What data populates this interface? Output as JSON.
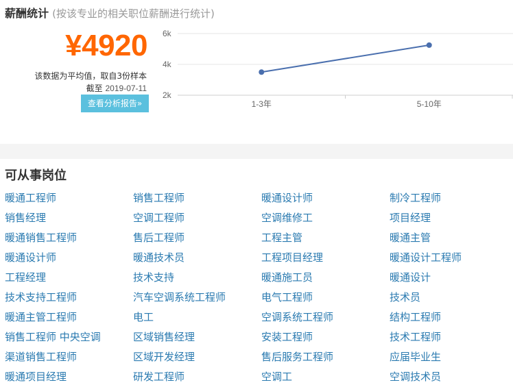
{
  "salary": {
    "title": "薪酬统计",
    "subtitle": "(按该专业的相关职位薪酬进行统计)",
    "value": "¥4920",
    "note": "该数据为平均值，取自3份样本",
    "date_prefix": "截至",
    "date": "2019-07-11",
    "report_button": "查看分析报告»"
  },
  "chart_data": {
    "type": "line",
    "categories": [
      "1-3年",
      "5-10年"
    ],
    "series": [
      {
        "values": [
          3500,
          5250
        ]
      }
    ],
    "y_ticks": [
      "6k",
      "4k",
      "2k"
    ],
    "ylim": [
      2000,
      6000
    ],
    "grid": true,
    "line_color": "#4a6fae"
  },
  "jobs": {
    "title": "可从事岗位",
    "items": [
      "暖通工程师",
      "销售工程师",
      "暖通设计师",
      "制冷工程师",
      "销售经理",
      "空调工程师",
      "空调维修工",
      "项目经理",
      "暖通销售工程师",
      "售后工程师",
      "工程主管",
      "暖通主管",
      "暖通设计师",
      "暖通技术员",
      "工程项目经理",
      "暖通设计工程师",
      "工程经理",
      "技术支持",
      "暖通施工员",
      "暖通设计",
      "技术支持工程师",
      "汽车空调系统工程师",
      "电气工程师",
      "技术员",
      "暖通主管工程师",
      "电工",
      "空调系统工程师",
      "结构工程师",
      "销售工程师 中央空调",
      "区域销售经理",
      "安装工程师",
      "技术工程师",
      "渠道销售工程师",
      "区域开发经理",
      "售后服务工程师",
      "应届毕业生",
      "暖通项目经理",
      "研发工程师",
      "空调工",
      "空调技术员"
    ]
  },
  "colors": {
    "accent": "#ff6600",
    "link": "#2a7ab0",
    "button": "#5bc0de"
  }
}
